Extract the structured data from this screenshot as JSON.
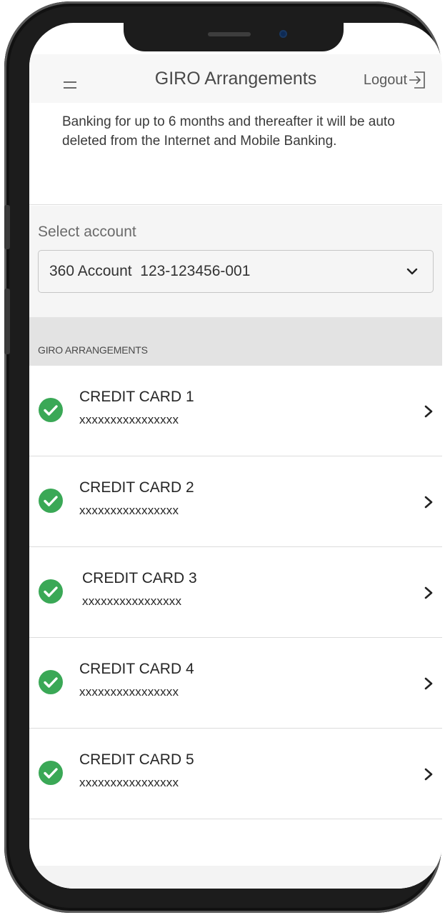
{
  "header": {
    "title": "GIRO Arrangements",
    "logout_label": "Logout",
    "menu_icon": "hamburger-icon",
    "logout_icon": "logout-arrow-icon"
  },
  "notice": {
    "text": "Banking for up to 6 months and thereafter it will be auto deleted from the Internet and Mobile Banking."
  },
  "account": {
    "label": "Select account",
    "selected": "360 Account  123-123456-001",
    "dropdown_icon": "chevron-down-icon"
  },
  "arrangements": {
    "section_title": "GIRO ARRANGEMENTS",
    "items": [
      {
        "title": "CREDIT CARD 1",
        "number": "xxxxxxxxxxxxxxxx"
      },
      {
        "title": "CREDIT CARD 2",
        "number": "xxxxxxxxxxxxxxxx"
      },
      {
        "title": "CREDIT CARD 3",
        "number": "xxxxxxxxxxxxxxxx"
      },
      {
        "title": "CREDIT CARD 4",
        "number": "xxxxxxxxxxxxxxxx"
      },
      {
        "title": "CREDIT CARD 5",
        "number": "xxxxxxxxxxxxxxxx"
      }
    ]
  },
  "colors": {
    "check_green": "#3aa856",
    "header_bg": "#f7f7f7",
    "section_bg": "#e3e3e3"
  }
}
